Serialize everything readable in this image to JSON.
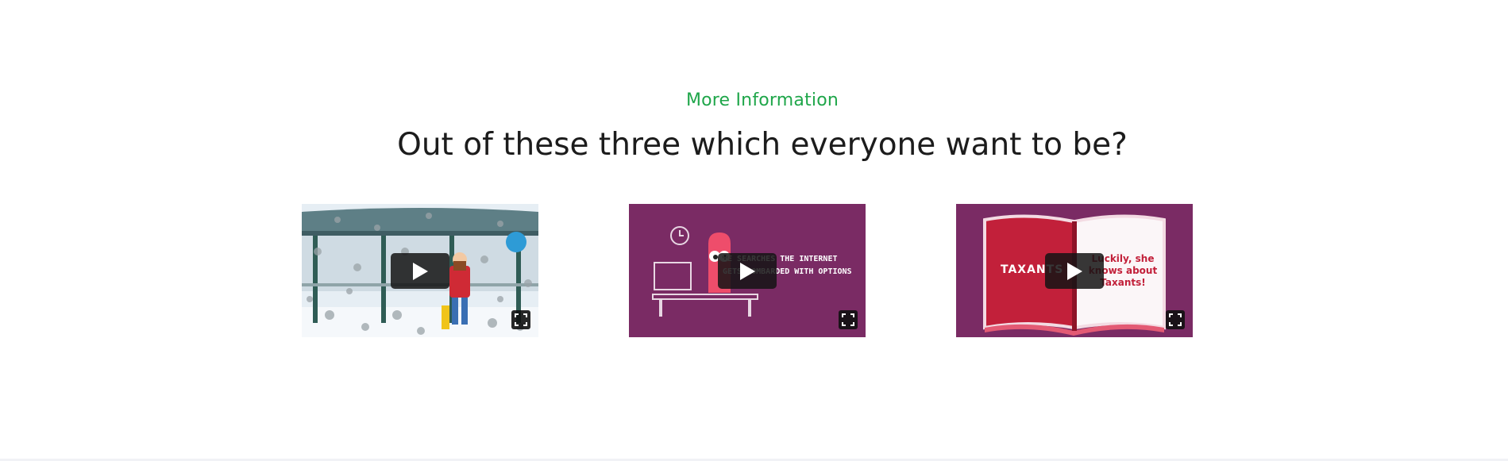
{
  "section": {
    "eyebrow": "More Information",
    "heading": "Out of these three which everyone want to be?"
  },
  "videos": [
    {
      "thumbnail": "winter-bus-stop-animation",
      "play_icon": "play-icon",
      "fullscreen_icon": "fullscreen-icon"
    },
    {
      "thumbnail": "character-at-desk-animation",
      "overlay_text": "HE SEARCHES THE INTERNET GETS BOMBARDED WITH OPTIONS",
      "play_icon": "play-icon",
      "fullscreen_icon": "fullscreen-icon"
    },
    {
      "thumbnail": "open-book-animation",
      "logo_text": "TAXANTS",
      "overlay_text": "Luckily, she knows about Taxants!",
      "play_icon": "play-icon",
      "fullscreen_icon": "fullscreen-icon"
    }
  ],
  "colors": {
    "accent": "#1fa64a",
    "heading": "#1c1c1c",
    "video_bg_purple": "#7a2b64"
  }
}
